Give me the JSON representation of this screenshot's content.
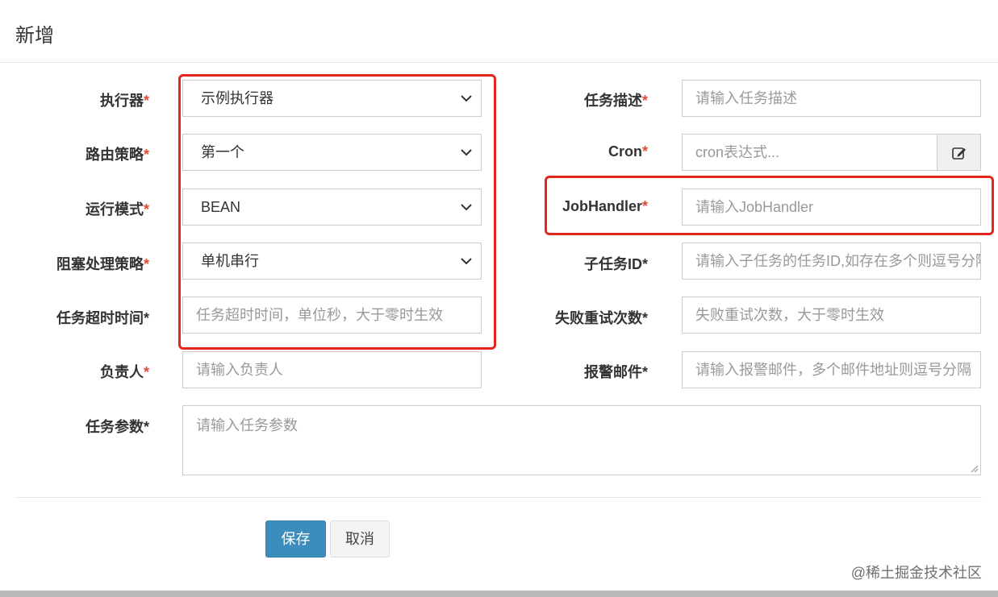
{
  "modal": {
    "title": "新增"
  },
  "required_mark": "*",
  "fields": {
    "executor": {
      "label": "执行器",
      "value": "示例执行器"
    },
    "route": {
      "label": "路由策略",
      "value": "第一个"
    },
    "run_mode": {
      "label": "运行模式",
      "value": "BEAN"
    },
    "block_strategy": {
      "label": "阻塞处理策略",
      "value": "单机串行"
    },
    "timeout": {
      "label": "任务超时时间*",
      "placeholder": "任务超时时间，单位秒，大于零时生效"
    },
    "author": {
      "label": "负责人",
      "placeholder": "请输入负责人"
    },
    "params": {
      "label": "任务参数*",
      "placeholder": "请输入任务参数"
    },
    "desc": {
      "label": "任务描述",
      "placeholder": "请输入任务描述"
    },
    "cron": {
      "label": "Cron",
      "placeholder": "cron表达式..."
    },
    "job_handler": {
      "label": "JobHandler",
      "placeholder": "请输入JobHandler"
    },
    "child_id": {
      "label": "子任务ID*",
      "placeholder": "请输入子任务的任务ID,如存在多个则逗号分隔"
    },
    "retry": {
      "label": "失败重试次数*",
      "placeholder": "失败重试次数，大于零时生效"
    },
    "alarm_email": {
      "label": "报警邮件*",
      "placeholder": "请输入报警邮件，多个邮件地址则逗号分隔"
    }
  },
  "buttons": {
    "save": "保存",
    "cancel": "取消"
  },
  "watermark": "@稀土掘金技术社区",
  "colors": {
    "primary": "#3c8dbc",
    "required": "#dd4b39",
    "highlight": "#e4261d"
  }
}
